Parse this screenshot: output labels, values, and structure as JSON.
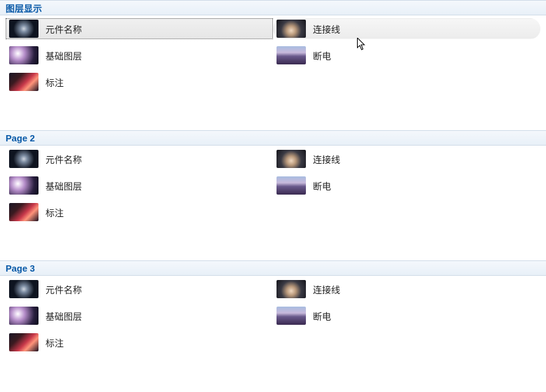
{
  "sections": [
    {
      "title": "图层显示",
      "selected": true
    },
    {
      "title": "Page 2",
      "selected": false
    },
    {
      "title": "Page 3",
      "selected": false
    }
  ],
  "items_left": [
    {
      "label": "元件名称",
      "thumb": "a"
    },
    {
      "label": "基础图层",
      "thumb": "b"
    },
    {
      "label": "标注",
      "thumb": "c"
    }
  ],
  "items_right": [
    {
      "label": "连接线",
      "thumb": "d"
    },
    {
      "label": "断电",
      "thumb": "e"
    }
  ]
}
